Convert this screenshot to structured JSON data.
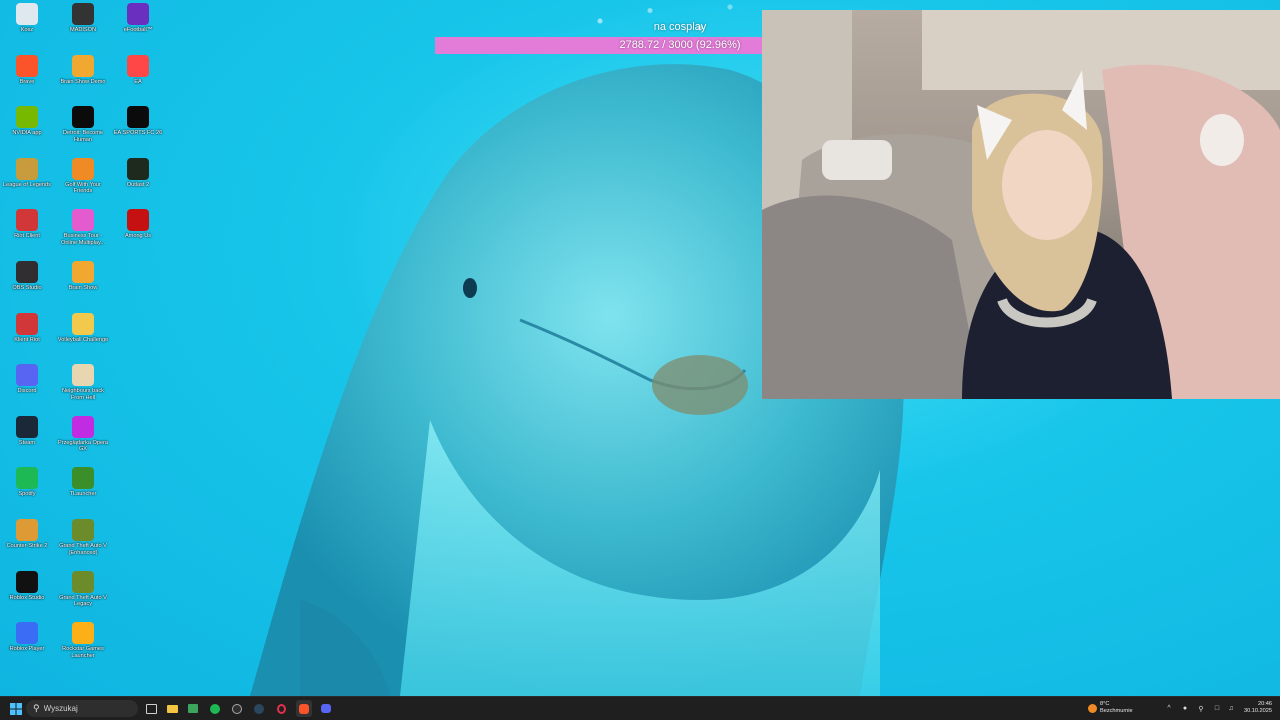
{
  "goal": {
    "title": "na cosplay",
    "progress_text": "2788.72 / 3000 (92.96%)",
    "fraction": 0.9296
  },
  "desktop_icons": [
    {
      "label": "Kosz",
      "icon": "recycle-bin-icon",
      "color": "#dfe8ef"
    },
    {
      "label": "Brave",
      "icon": "brave-icon",
      "color": "#fb542b"
    },
    {
      "label": "NVIDIA app",
      "icon": "nvidia-icon",
      "color": "#76b900"
    },
    {
      "label": "League of Legends",
      "icon": "league-icon",
      "color": "#c89b3c"
    },
    {
      "label": "Riot Client",
      "icon": "riot-icon",
      "color": "#d13639"
    },
    {
      "label": "OBS Studio",
      "icon": "obs-icon",
      "color": "#302e31"
    },
    {
      "label": "Klient Riot",
      "icon": "riot-icon",
      "color": "#d13639"
    },
    {
      "label": "Discord",
      "icon": "discord-icon",
      "color": "#5865f2"
    },
    {
      "label": "Steam",
      "icon": "steam-icon",
      "color": "#1b2838"
    },
    {
      "label": "Spotify",
      "icon": "spotify-icon",
      "color": "#1db954"
    },
    {
      "label": "Counter-Strike 2",
      "icon": "cs2-icon",
      "color": "#de9b35"
    },
    {
      "label": "Roblox Studio",
      "icon": "roblox-studio-icon",
      "color": "#111111"
    },
    {
      "label": "Roblox Player",
      "icon": "roblox-icon",
      "color": "#3b6cf6"
    },
    {
      "label": "MADISON",
      "icon": "madison-icon",
      "color": "#333333"
    },
    {
      "label": "Brain Show Demo",
      "icon": "brain-show-icon",
      "color": "#f0a830"
    },
    {
      "label": "Detroit: Become Human",
      "icon": "detroit-icon",
      "color": "#0b0b0b"
    },
    {
      "label": "Golf With Your Friends",
      "icon": "golf-icon",
      "color": "#f08a24"
    },
    {
      "label": "Business Tour - Online Multiplay...",
      "icon": "business-tour-icon",
      "color": "#e45bd0"
    },
    {
      "label": "Brain Show",
      "icon": "brain-show-icon",
      "color": "#f0a830"
    },
    {
      "label": "Volleyball Challenge",
      "icon": "volleyball-icon",
      "color": "#f2c94c"
    },
    {
      "label": "Neighbours back From Hell",
      "icon": "neighbours-icon",
      "color": "#e8d6b0"
    },
    {
      "label": "Przeglądarka Opera GX",
      "icon": "opera-gx-icon",
      "color": "#c12be1"
    },
    {
      "label": "TLauncher",
      "icon": "tlauncher-icon",
      "color": "#3b8f2b"
    },
    {
      "label": "Grand Theft Auto V (Enhanced)",
      "icon": "gta-icon",
      "color": "#6c8c2c"
    },
    {
      "label": "Grand Theft Auto V Legacy",
      "icon": "gta-icon",
      "color": "#6c8c2c"
    },
    {
      "label": "Rockstar Games Launcher",
      "icon": "rockstar-icon",
      "color": "#fcaf17"
    },
    {
      "label": "eFootball™",
      "icon": "efootball-icon",
      "color": "#6b2fbf"
    },
    {
      "label": "EA",
      "icon": "ea-icon",
      "color": "#ff4747"
    },
    {
      "label": "EA SPORTS FC 26",
      "icon": "fc26-icon",
      "color": "#0b0b0b"
    },
    {
      "label": "Outlast 2",
      "icon": "outlast-icon",
      "color": "#1d2a1d"
    },
    {
      "label": "Among Us",
      "icon": "among-us-icon",
      "color": "#c51111"
    }
  ],
  "taskbar": {
    "search_placeholder": "Wyszukaj",
    "weather_temp": "8°C",
    "weather_desc": "Bezchmurnie",
    "time": "20:46",
    "date": "30.10.2025"
  }
}
